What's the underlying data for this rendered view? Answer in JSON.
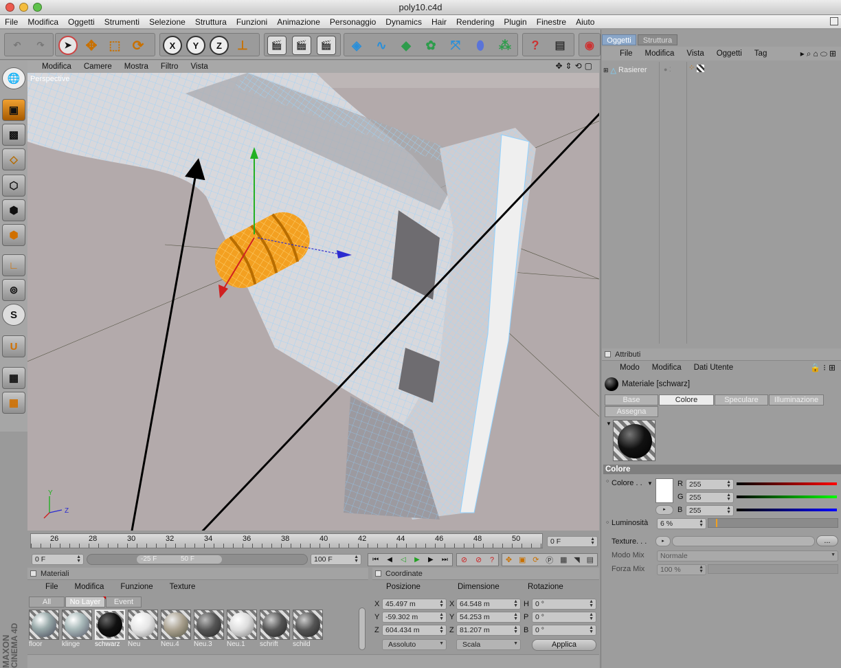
{
  "window": {
    "title": "poly10.c4d"
  },
  "menubar": [
    "File",
    "Modifica",
    "Oggetti",
    "Strumenti",
    "Selezione",
    "Struttura",
    "Funzioni",
    "Animazione",
    "Personaggio",
    "Dynamics",
    "Hair",
    "Rendering",
    "Plugin",
    "Finestre",
    "Aiuto"
  ],
  "viewport": {
    "menu": [
      "Modifica",
      "Camere",
      "Mostra",
      "Filtro",
      "Vista"
    ],
    "label": "Perspective",
    "axis_labels": {
      "y": "Y",
      "x": "X",
      "z": "Z"
    }
  },
  "toolbar_axes": [
    "X",
    "Y",
    "Z"
  ],
  "timeline": {
    "ticks": [
      "26",
      "28",
      "30",
      "32",
      "34",
      "36",
      "38",
      "40",
      "42",
      "44",
      "46",
      "48",
      "50"
    ],
    "current_frame": "0 F",
    "start_field": "0 F",
    "range_start": "-25 F",
    "range_end": "50 F",
    "end_field": "100 F"
  },
  "materials": {
    "title": "Materiali",
    "menu": [
      "File",
      "Modifica",
      "Funzione",
      "Texture"
    ],
    "filters": [
      "All",
      "No Layer",
      "Event"
    ],
    "items": [
      "floor",
      "klinge",
      "schwarz",
      "Neu",
      "Neu.4",
      "Neu.3",
      "Neu.1",
      "schrift",
      "schild"
    ]
  },
  "coordinates": {
    "title": "Coordinate",
    "headers": [
      "Posizione",
      "Dimensione",
      "Rotazione"
    ],
    "rows": [
      {
        "axis": "X",
        "pos": "45.497 m",
        "dim_axis": "X",
        "dim": "64.548 m",
        "rot_axis": "H",
        "rot": "0 °"
      },
      {
        "axis": "Y",
        "pos": "-59.302 m",
        "dim_axis": "Y",
        "dim": "54.253 m",
        "rot_axis": "P",
        "rot": "0 °"
      },
      {
        "axis": "Z",
        "pos": "604.434 m",
        "dim_axis": "Z",
        "dim": "81.207 m",
        "rot_axis": "B",
        "rot": "0 °"
      }
    ],
    "mode1": "Assoluto",
    "mode2": "Scala",
    "apply": "Applica"
  },
  "objects": {
    "tabs": [
      "Oggetti",
      "Struttura"
    ],
    "menu": [
      "File",
      "Modifica",
      "Vista",
      "Oggetti",
      "Tag"
    ],
    "tree": [
      {
        "name": "Rasierer"
      }
    ]
  },
  "attributes": {
    "title": "Attributi",
    "menu": [
      "Modo",
      "Modifica",
      "Dati Utente"
    ],
    "material_name": "Materiale [schwarz]",
    "tabs": [
      "Base",
      "Colore",
      "Speculare",
      "Illuminazione",
      "Assegna"
    ],
    "active_tab": "Colore",
    "section": "Colore",
    "color_label": "Colore . .",
    "r_label": "R",
    "g_label": "G",
    "b_label": "B",
    "r": "255",
    "g": "255",
    "b": "255",
    "luminosity_label": "Luminosità",
    "luminosity": "6 %",
    "luminosity_fraction": 0.06,
    "texture_label": "Texture. . .",
    "texture_btn": "...",
    "mix_mode_label": "Modo Mix",
    "mix_mode": "Normale",
    "mix_strength_label": "Forza Mix",
    "mix_strength": "100 %"
  },
  "branding": {
    "line1": "MAXON",
    "line2": "CINEMA 4D"
  },
  "colors": {
    "selected_object": "#f5a623",
    "wire_highlight": "#8ed4ff",
    "panel_bg": "#9a9a9a"
  }
}
